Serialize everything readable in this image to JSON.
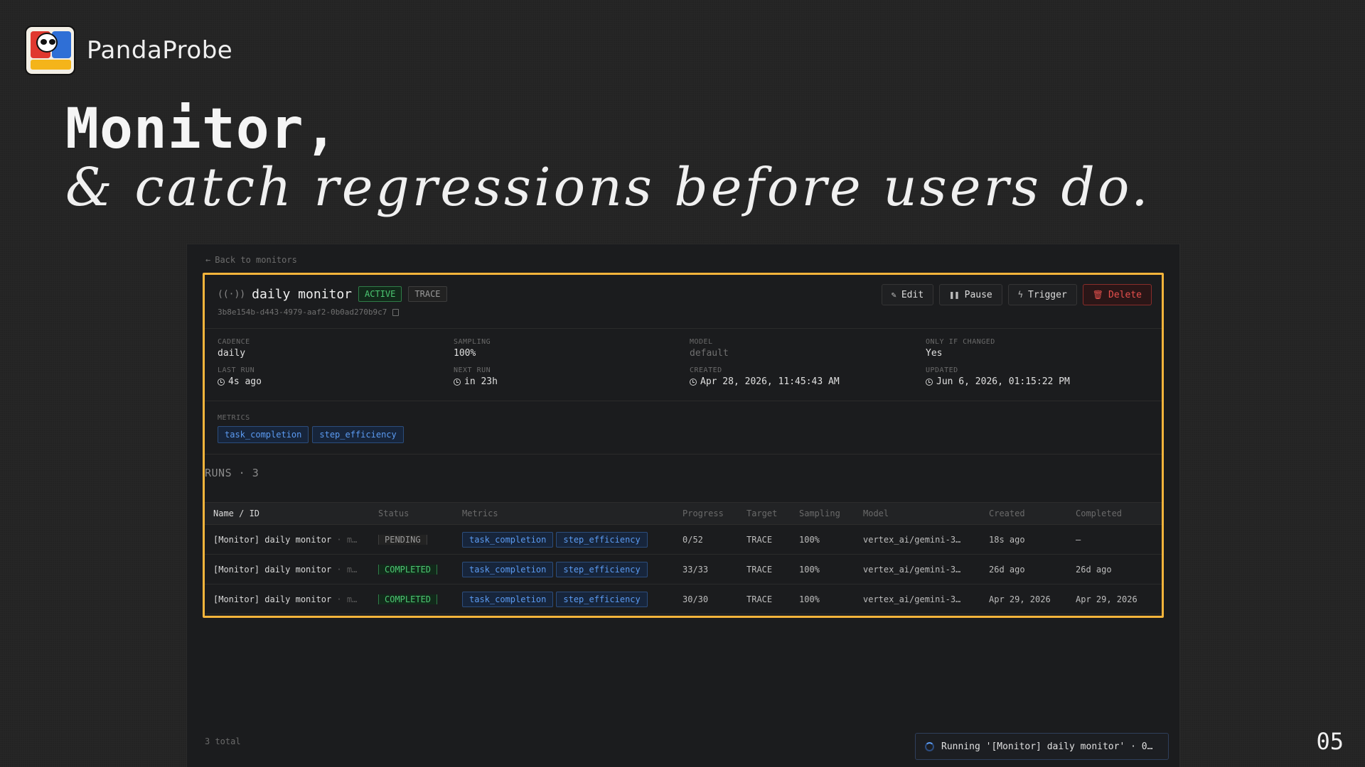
{
  "brand": {
    "name": "PandaProbe"
  },
  "headline": {
    "line1": "Monitor,",
    "line2": "& catch regressions before users do."
  },
  "slide_number": "05",
  "nav": {
    "back_label": "Back to monitors"
  },
  "monitor": {
    "name": "daily monitor",
    "status_badge": "ACTIVE",
    "target_badge": "TRACE",
    "id": "3b8e154b-d443-4979-aaf2-0b0ad270b9c7"
  },
  "actions": {
    "edit": "Edit",
    "pause": "Pause",
    "trigger": "Trigger",
    "delete": "Delete"
  },
  "details": {
    "cadence": {
      "label": "CADENCE",
      "value": "daily"
    },
    "sampling": {
      "label": "SAMPLING",
      "value": "100%"
    },
    "model": {
      "label": "MODEL",
      "value": "default"
    },
    "only_if_changed": {
      "label": "ONLY IF CHANGED",
      "value": "Yes"
    },
    "last_run": {
      "label": "LAST RUN",
      "value": "4s ago"
    },
    "next_run": {
      "label": "NEXT RUN",
      "value": "in 23h"
    },
    "created": {
      "label": "CREATED",
      "value": "Apr 28, 2026, 11:45:43 AM"
    },
    "updated": {
      "label": "UPDATED",
      "value": "Jun 6, 2026, 01:15:22 PM"
    }
  },
  "metrics": {
    "label": "METRICS",
    "items": [
      "task_completion",
      "step_efficiency"
    ]
  },
  "runs": {
    "title": "RUNS · 3",
    "columns": [
      "Name / ID",
      "Status",
      "Metrics",
      "Progress",
      "Target",
      "Sampling",
      "Model",
      "Created",
      "Completed"
    ],
    "rows": [
      {
        "name": "[Monitor] daily monitor",
        "sub": " · m…",
        "status": "PENDING",
        "m1": "task_completion",
        "m2": "step_efficiency",
        "progress": "0/52",
        "target": "TRACE",
        "sampling": "100%",
        "model": "vertex_ai/gemini-3…",
        "created": "18s ago",
        "completed": "—"
      },
      {
        "name": "[Monitor] daily monitor",
        "sub": " · m…",
        "status": "COMPLETED",
        "m1": "task_completion",
        "m2": "step_efficiency",
        "progress": "33/33",
        "target": "TRACE",
        "sampling": "100%",
        "model": "vertex_ai/gemini-3…",
        "created": "26d ago",
        "completed": "26d ago"
      },
      {
        "name": "[Monitor] daily monitor",
        "sub": " · m…",
        "status": "COMPLETED",
        "m1": "task_completion",
        "m2": "step_efficiency",
        "progress": "30/30",
        "target": "TRACE",
        "sampling": "100%",
        "model": "vertex_ai/gemini-3…",
        "created": "Apr 29, 2026",
        "completed": "Apr 29, 2026"
      }
    ],
    "total": "3 total"
  },
  "toast": {
    "text": "Running '[Monitor] daily monitor' · 0…"
  },
  "colors": {
    "highlight": "#f5b43b",
    "active": "#4cc872",
    "metric_tag": "#5b9bf2",
    "danger": "#e8504d"
  }
}
